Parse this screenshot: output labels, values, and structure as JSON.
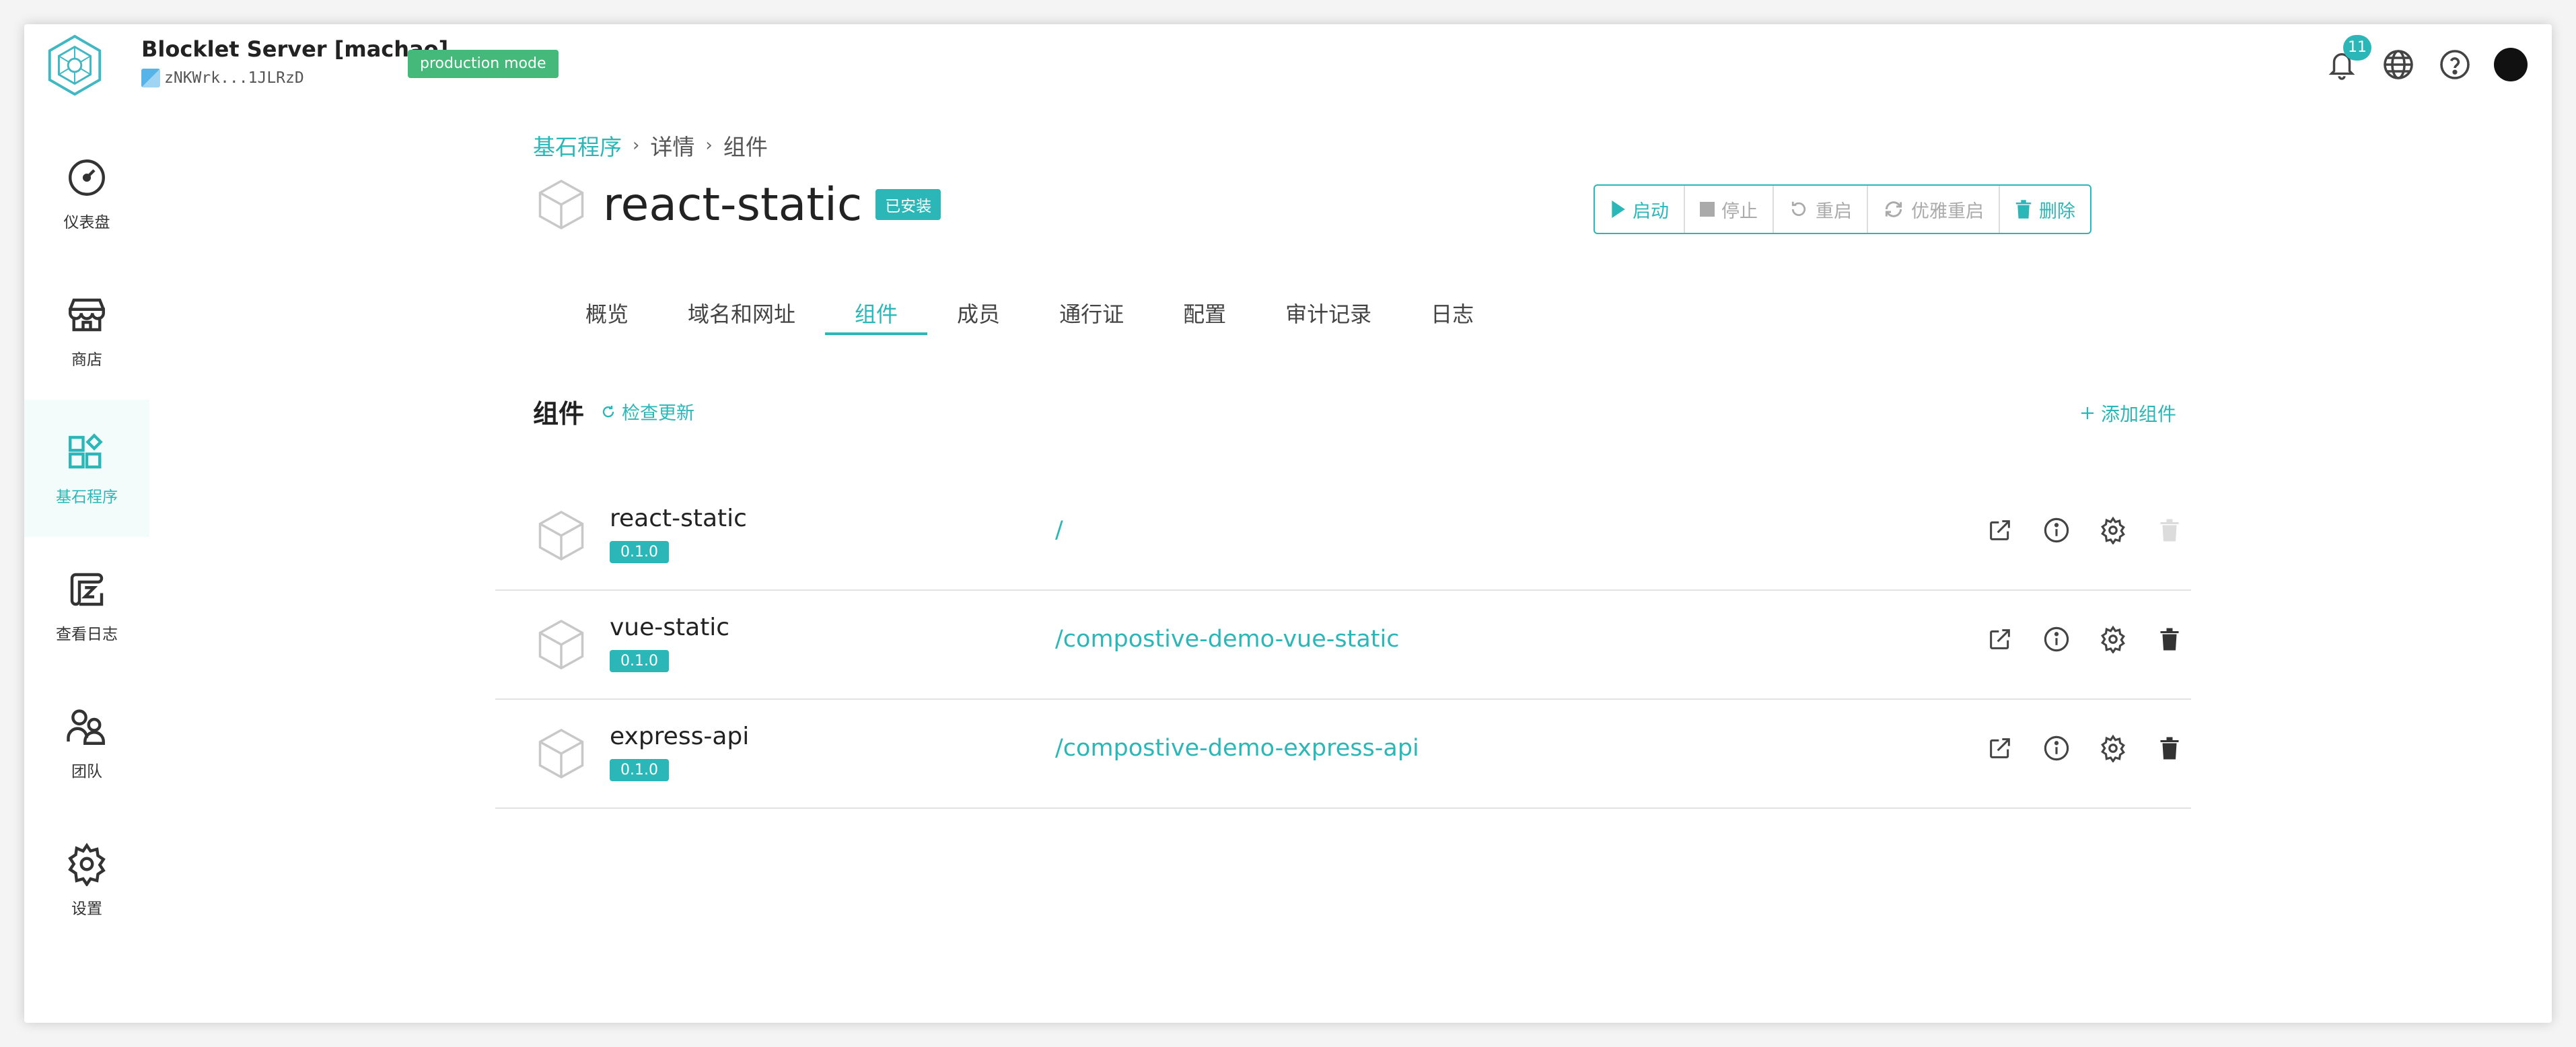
{
  "header": {
    "app_title": "Blocklet Server [machao]",
    "did": "zNKWrk...1JLRzD",
    "mode_badge": "production mode",
    "notification_count": "11",
    "icons": [
      "bell-icon",
      "globe-icon",
      "help-icon",
      "avatar"
    ]
  },
  "sidebar": {
    "items": [
      {
        "label": "仪表盘",
        "icon": "dashboard-icon"
      },
      {
        "label": "商店",
        "icon": "store-icon"
      },
      {
        "label": "基石程序",
        "icon": "blocklets-icon",
        "active": true
      },
      {
        "label": "查看日志",
        "icon": "logs-icon"
      },
      {
        "label": "团队",
        "icon": "team-icon"
      },
      {
        "label": "设置",
        "icon": "settings-icon"
      }
    ]
  },
  "breadcrumb": [
    "基石程序",
    "详情",
    "组件"
  ],
  "page": {
    "title": "react-static",
    "status_badge": "已安装"
  },
  "actions": [
    {
      "label": "启动",
      "icon": "play-icon",
      "enabled": true
    },
    {
      "label": "停止",
      "icon": "stop-icon",
      "enabled": false
    },
    {
      "label": "重启",
      "icon": "restart-icon",
      "enabled": false
    },
    {
      "label": "优雅重启",
      "icon": "graceful-restart-icon",
      "enabled": false
    },
    {
      "label": "删除",
      "icon": "trash-icon",
      "enabled": true
    }
  ],
  "tabs": [
    "概览",
    "域名和网址",
    "组件",
    "成员",
    "通行证",
    "配置",
    "审计记录",
    "日志"
  ],
  "active_tab": "组件",
  "components_section": {
    "title": "组件",
    "check_update": "检查更新",
    "add_component": "添加组件"
  },
  "components": [
    {
      "name": "react-static",
      "version": "0.1.0",
      "path": "/",
      "delete_enabled": false
    },
    {
      "name": "vue-static",
      "version": "0.1.0",
      "path": "/compostive-demo-vue-static",
      "delete_enabled": true
    },
    {
      "name": "express-api",
      "version": "0.1.0",
      "path": "/compostive-demo-express-api",
      "delete_enabled": true
    }
  ],
  "colors": {
    "accent": "#2bb7b7",
    "mode_badge": "#44b97a",
    "disabled": "#aaaaaa"
  }
}
